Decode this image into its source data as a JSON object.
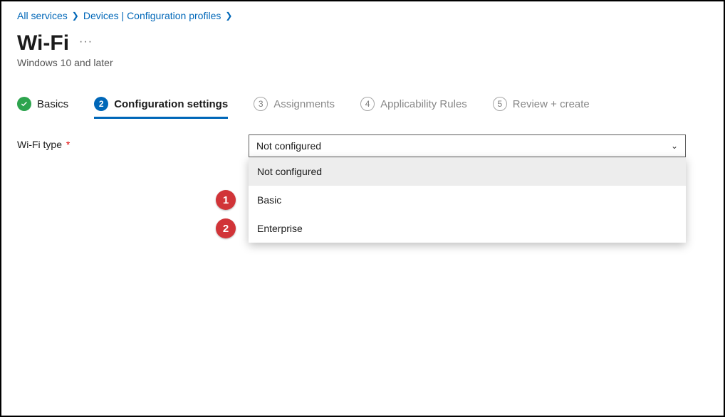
{
  "breadcrumb": {
    "item1": "All services",
    "item2": "Devices | Configuration profiles"
  },
  "header": {
    "title": "Wi-Fi",
    "more": "···",
    "subtitle": "Windows 10 and later"
  },
  "wizard": {
    "s1": {
      "label": "Basics"
    },
    "s2": {
      "num": "2",
      "label": "Configuration settings"
    },
    "s3": {
      "num": "3",
      "label": "Assignments"
    },
    "s4": {
      "num": "4",
      "label": "Applicability Rules"
    },
    "s5": {
      "num": "5",
      "label": "Review + create"
    }
  },
  "form": {
    "wifi_type_label": "Wi-Fi type",
    "required": "*",
    "selected_value": "Not configured",
    "options": {
      "o0": "Not configured",
      "o1": "Basic",
      "o2": "Enterprise"
    }
  },
  "annotations": {
    "b1": "1",
    "b2": "2"
  }
}
